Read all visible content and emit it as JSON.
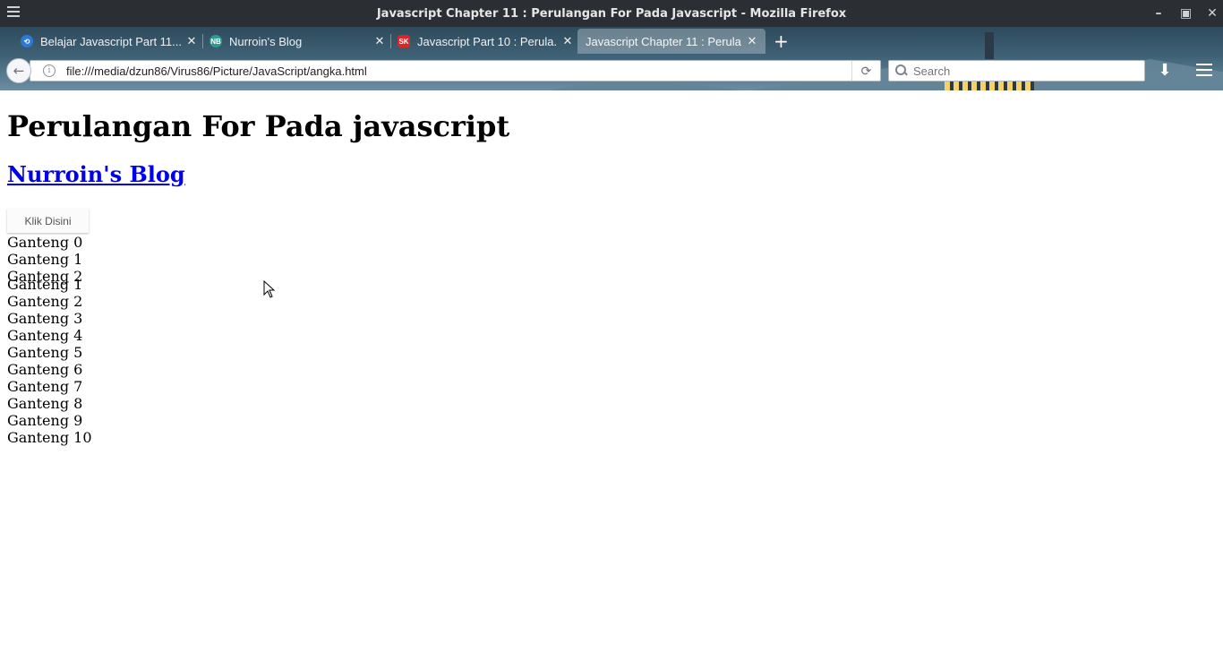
{
  "window": {
    "title": "Javascript Chapter 11 : Perulangan For Pada Javascript - Mozilla Firefox"
  },
  "tabs": [
    {
      "label": "Belajar Javascript Part 11...",
      "favicon": "",
      "favicon_color": "#2a7ad6"
    },
    {
      "label": "Nurroin's Blog",
      "favicon": "NB",
      "favicon_color": "#2a9d8f"
    },
    {
      "label": "Javascript Part 10 : Perula...",
      "favicon": "SK",
      "favicon_color": "#d62828"
    },
    {
      "label": "Javascript Chapter 11 : Perula...",
      "favicon": "",
      "favicon_color": "transparent",
      "active": true
    }
  ],
  "navbar": {
    "url": "file:///media/dzun86/Virus86/Picture/JavaScript/angka.html",
    "search_placeholder": "Search"
  },
  "page": {
    "heading": "Perulangan For Pada javascript",
    "link_text": "Nurroin's Blog",
    "button_label": "Klik Disini",
    "output_lines": [
      "Ganteng 0",
      "Ganteng 1",
      "Ganteng 2",
      "Ganteng 1",
      "Ganteng 2",
      "Ganteng 3",
      "Ganteng 4",
      "Ganteng 5",
      "Ganteng 6",
      "Ganteng 7",
      "Ganteng 8",
      "Ganteng 9",
      "Ganteng 10"
    ]
  }
}
